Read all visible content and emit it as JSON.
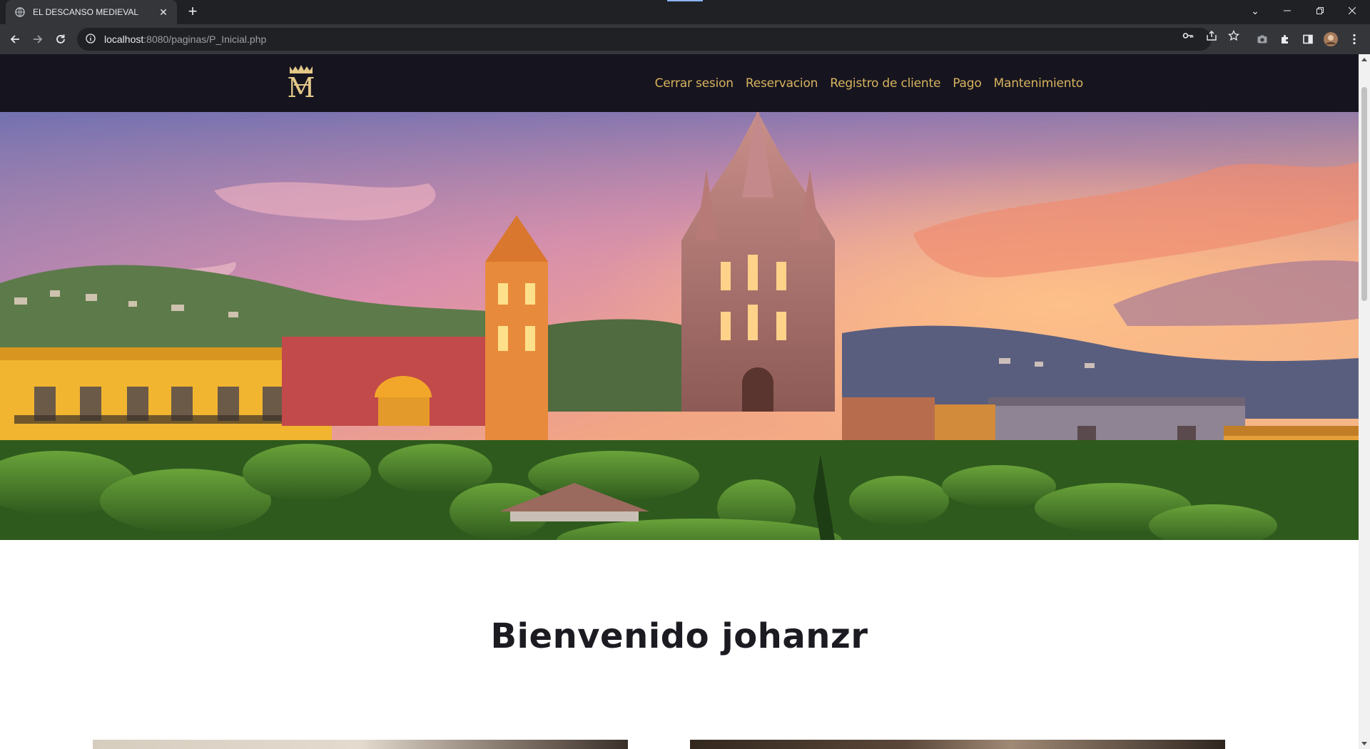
{
  "browser": {
    "tab_title": "EL DESCANSO MEDIEVAL",
    "url_host": "localhost",
    "url_rest": ":8080/paginas/P_Inicial.php",
    "icons": [
      "globe-icon",
      "close-icon",
      "plus-icon",
      "back-icon",
      "forward-icon",
      "reload-icon",
      "info-icon",
      "key-icon",
      "share-icon",
      "star-icon",
      "camera-icon",
      "puzzle-icon",
      "sidepanel-icon",
      "avatar",
      "kebab-menu-icon",
      "minimize-icon",
      "restore-icon",
      "window-close-icon",
      "tab-search-icon"
    ]
  },
  "site": {
    "logo_text": "M",
    "nav": {
      "logout": "Cerrar sesion",
      "reservation": "Reservacion",
      "client_registry": "Registro de cliente",
      "payment": "Pago",
      "maintenance": "Mantenimiento"
    },
    "welcome": "Bienvenido johanzr",
    "colors": {
      "header_bg": "#16151f",
      "nav_text": "#d8b35f",
      "heading": "#1c1b22"
    }
  }
}
